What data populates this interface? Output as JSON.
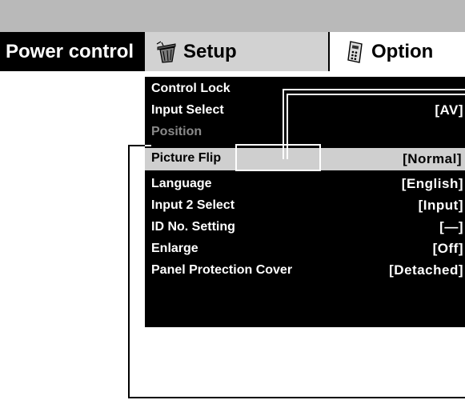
{
  "tabs": {
    "power_control": "Power control",
    "setup": "Setup",
    "option": "Option"
  },
  "icons": {
    "setup": "trash-can-icon",
    "option": "remote-control-icon"
  },
  "menu": {
    "items": [
      {
        "label": "Control Lock",
        "value": ""
      },
      {
        "label": "Input Select",
        "value": "[AV]"
      },
      {
        "label": "Position",
        "value": ""
      },
      {
        "label": "Picture Flip",
        "value": "[Normal]"
      },
      {
        "label": "Language",
        "value": "[English]"
      },
      {
        "label": "Input 2 Select",
        "value": "[Input]"
      },
      {
        "label": "ID No. Setting",
        "value": "[—]"
      },
      {
        "label": "Enlarge",
        "value": "[Off]"
      },
      {
        "label": "Panel Protection Cover",
        "value": "[Detached]"
      }
    ]
  },
  "colors": {
    "menu_background": "#000000",
    "selected_row": "#cfcfcf",
    "setup_tab": "#d2d2d2",
    "top_bar": "#b9b9b9",
    "dimmed_text": "#8a8a8a"
  }
}
